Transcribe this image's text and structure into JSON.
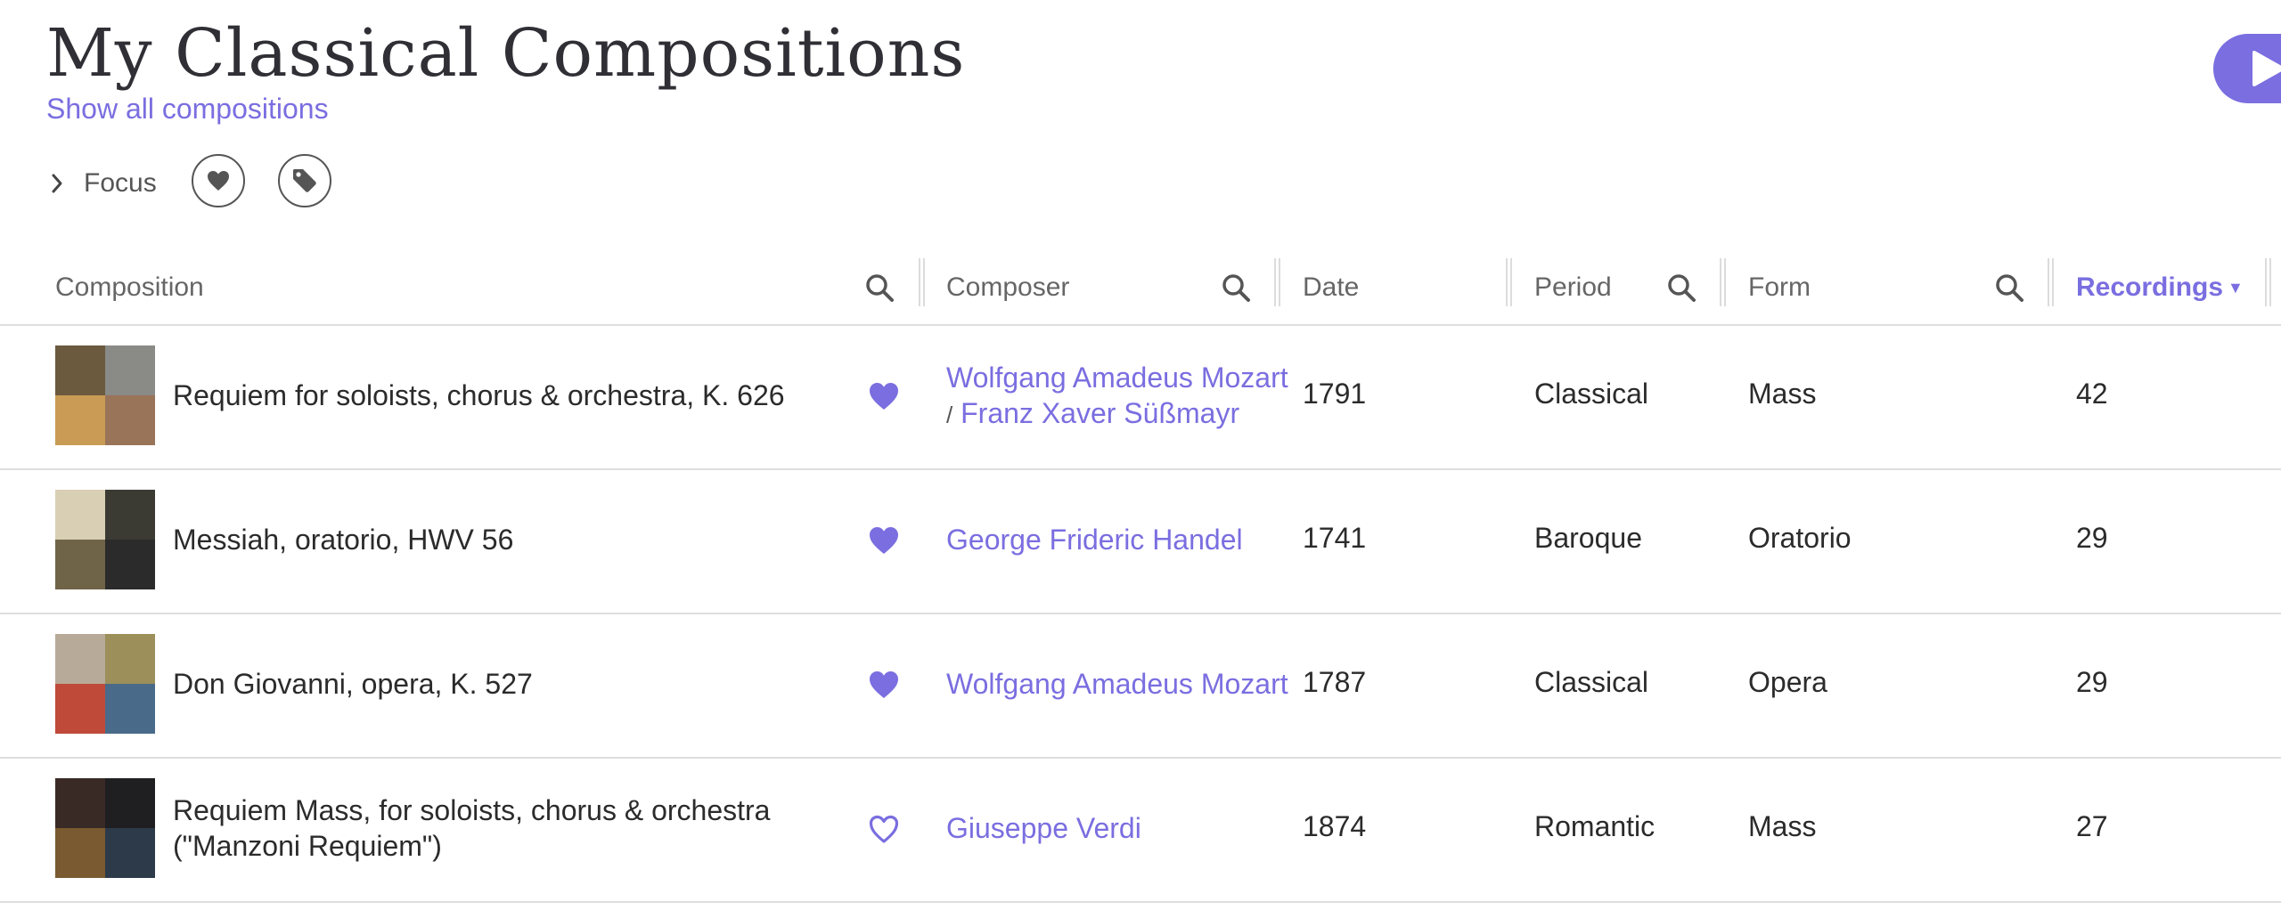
{
  "page": {
    "title": "My Classical Compositions",
    "show_all_link": "Show all compositions",
    "focus_label": "Focus",
    "accent_color": "#7a6ee0"
  },
  "icons": {
    "play": "play-icon",
    "chevron": "chevron-right-icon",
    "favorite_filter": "heart-icon",
    "tag_filter": "tag-icon",
    "search": "search-icon",
    "favorite_filled": "heart-filled-icon",
    "favorite_outline": "heart-outline-icon"
  },
  "table": {
    "columns": {
      "composition": "Composition",
      "composer": "Composer",
      "date": "Date",
      "period": "Period",
      "form": "Form",
      "recordings": "Recordings",
      "sort_indicator": "▼"
    },
    "rows": [
      {
        "title": "Requiem for soloists, chorus & orchestra, K. 626",
        "favorite": true,
        "composer": "Wolfgang Amadeus Mozart",
        "composer_sep": "/",
        "composer2": "Franz Xaver Süßmayr",
        "date": "1791",
        "period": "Classical",
        "form": "Mass",
        "recordings": "42",
        "cover_colors": [
          "#6b5a3e",
          "#8a8a86",
          "#c99b55",
          "#9a7458"
        ]
      },
      {
        "title": "Messiah, oratorio, HWV 56",
        "favorite": true,
        "composer": "George Frideric Handel",
        "date": "1741",
        "period": "Baroque",
        "form": "Oratorio",
        "recordings": "29",
        "cover_colors": [
          "#d9cfb4",
          "#3b3b34",
          "#6f6448",
          "#2b2b2b"
        ]
      },
      {
        "title": "Don Giovanni, opera, K. 527",
        "favorite": true,
        "composer": "Wolfgang Amadeus Mozart",
        "date": "1787",
        "period": "Classical",
        "form": "Opera",
        "recordings": "29",
        "cover_colors": [
          "#b8aa98",
          "#9c8f5a",
          "#c04a3a",
          "#4a6a8a"
        ]
      },
      {
        "title": "Requiem Mass, for soloists, chorus & orchestra (\"Manzoni Requiem\")",
        "favorite": false,
        "composer": "Giuseppe Verdi",
        "date": "1874",
        "period": "Romantic",
        "form": "Mass",
        "recordings": "27",
        "cover_colors": [
          "#3a2a26",
          "#1f1f22",
          "#7a5a30",
          "#2c3a4a"
        ]
      }
    ]
  }
}
